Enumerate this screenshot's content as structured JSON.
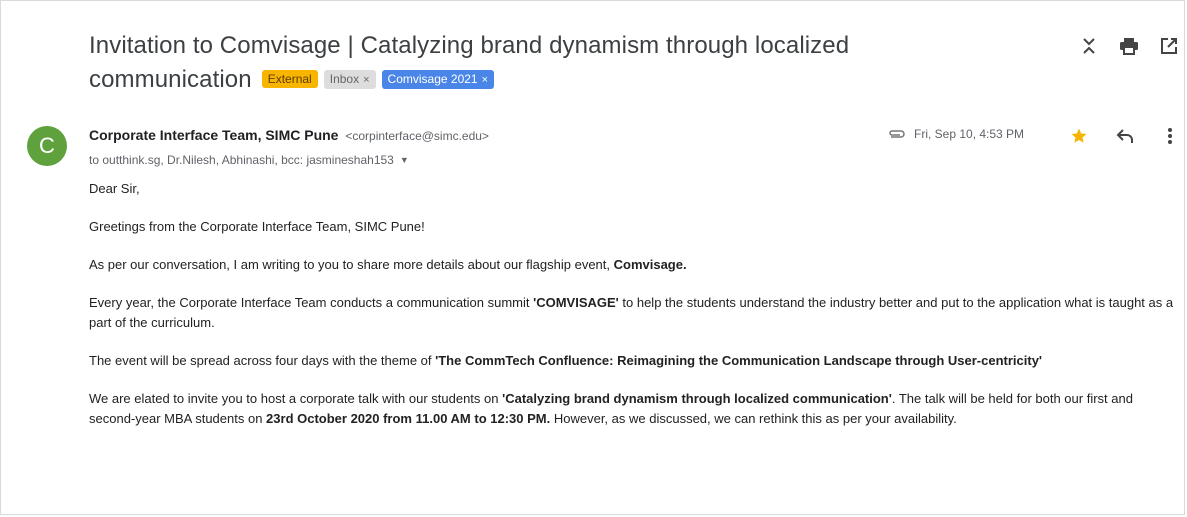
{
  "email": {
    "subject_line1": "Invitation to Comvisage | Catalyzing brand dynamism through localized",
    "subject_line2": "communication",
    "labels": {
      "external": "External",
      "inbox": "Inbox",
      "comvisage": "Comvisage 2021",
      "remove_glyph": "×"
    },
    "toolbar_icons": [
      "collapse-all-icon",
      "print-icon",
      "open-in-new-window-icon"
    ],
    "sender": {
      "avatar_letter": "C",
      "avatar_color": "#5ea13d",
      "name": "Corporate Interface Team, SIMC Pune",
      "email": "<corpinterface@simc.edu>"
    },
    "recipients": "to outthink.sg, Dr.Nilesh, Abhinashi, bcc: jasmineshah153",
    "date": "Fri, Sep 10, 4:53 PM",
    "star_color": "#f4b400",
    "body": {
      "greeting": "Dear Sir,",
      "p1": "Greetings from the Corporate Interface Team, SIMC Pune!",
      "p2_pre": "As per our conversation, I am writing to you to share more details about our flagship event, ",
      "p2_bold": "Comvisage.",
      "p3_pre": "Every year, the Corporate Interface Team conducts a communication summit ",
      "p3_bold": "'COMVISAGE'",
      "p3_post": " to help the students understand the industry better and put to the application what is taught as a part of the curriculum.",
      "p4_pre": "The event will be spread across four days with the theme of ",
      "p4_bold": "'The CommTech Confluence: Reimagining the Communication Landscape through User-centricity'",
      "p5_pre": "We are elated to invite you to host a corporate talk with our students on ",
      "p5_bold1": "'Catalyzing brand dynamism through localized communication'",
      "p5_mid": ". The talk will be held for both our first and second-year MBA students on ",
      "p5_bold2": "23rd October 2020 from 11.00 AM to 12:30 PM.",
      "p5_post": " However, as we discussed, we can rethink this as per your availability."
    }
  }
}
